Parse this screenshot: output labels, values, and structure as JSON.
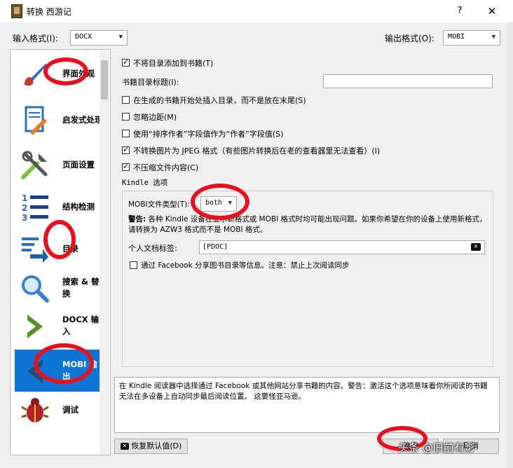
{
  "window": {
    "title": "转换 西游记",
    "help": "?",
    "close": "✕"
  },
  "formats": {
    "input_label": "输入格式(I):",
    "input_value": "DOCX",
    "output_label": "输出格式(O):",
    "output_value": "MOBI"
  },
  "sidebar": {
    "items": [
      {
        "label": "界面外观",
        "icon": "brush-icon"
      },
      {
        "label": "启发式处理",
        "icon": "document-wand-icon"
      },
      {
        "label": "页面设置",
        "icon": "tools-icon"
      },
      {
        "label": "结构检测",
        "icon": "list-numbered-icon"
      },
      {
        "label": "目录",
        "icon": "toc-icon"
      },
      {
        "label": "搜索 & 替换",
        "icon": "magnifier-icon"
      },
      {
        "label": "DOCX 输入",
        "icon": "chevron-right-icon"
      },
      {
        "label": "MOBI 输出",
        "icon": "chevron-left-icon",
        "selected": true
      },
      {
        "label": "调试",
        "icon": "bug-icon"
      }
    ]
  },
  "options": {
    "no_toc_label": "不将目录添加到书籍(T)",
    "toc_title_label": "书籍目录标题(I):",
    "toc_title_value": "",
    "toc_at_start_label": "在生成的书籍开始处插入目录，而不是放在末尾(S)",
    "ignore_margins_label": "忽略边距(M)",
    "author_sort_label": "使用“排序作者”字段值作为“作者”字段值(S)",
    "no_jpeg_label": "不转换图片为 JPEG 格式（有些图片转换后在老的查看器里无法查看）(I)",
    "no_compress_label": "不压缩文件内容(C)"
  },
  "kindle": {
    "group_title": "Kindle 选项",
    "file_type_label": "MOBI文件类型(T):",
    "file_type_value": "both",
    "warning_bold": "警告:",
    "warning_text": "各种 Kindle 设备在显示新格式或 MOBI 格式时均可能出现问题。如果你希望在你的设备上使用新格式，请转换为 AZW3 格式而不是 MOBI 格式。",
    "doctype_label": "个人文档标签:",
    "doctype_value": "[PDOC]",
    "share_label": "通过 Facebook 分享图书目录等信息。注意：禁止上次阅读同步"
  },
  "description": "在 Kindle 阅读器中选择通过 Facebook 或其他网站分享书籍的内容。警告：激活这个选项意味着你所阅读的书籍无法在多设备上自动同步最后阅读位置。 这要怪亚马逊。",
  "buttons": {
    "restore_defaults": "恢复默认值(D)",
    "ok": "确定",
    "cancel": "取消"
  },
  "watermark": "头条 @旧前有影"
}
